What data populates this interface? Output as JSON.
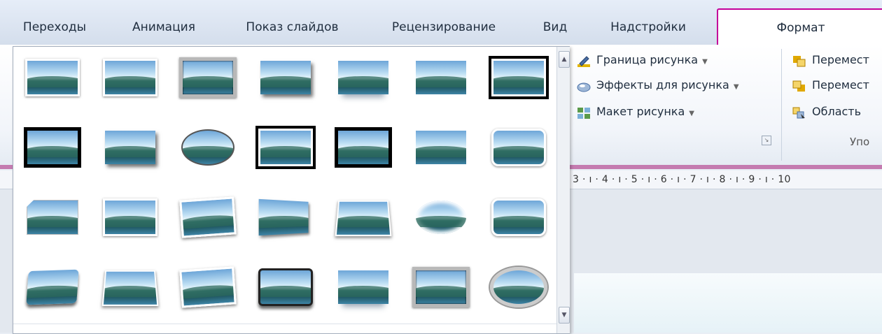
{
  "tabs": [
    {
      "label": "Переходы",
      "active": false
    },
    {
      "label": "Анимация",
      "active": false
    },
    {
      "label": "Показ слайдов",
      "active": false
    },
    {
      "label": "Рецензирование",
      "active": false
    },
    {
      "label": "Вид",
      "active": false
    },
    {
      "label": "Надстройки",
      "active": false
    },
    {
      "label": "Формат",
      "active": true
    }
  ],
  "picture_styles_group": {
    "commands": [
      {
        "label": "Граница рисунка",
        "icon": "pen-border-icon",
        "has_dropdown": true
      },
      {
        "label": "Эффекты для рисунка",
        "icon": "effects-icon",
        "has_dropdown": true
      },
      {
        "label": "Макет рисунка",
        "icon": "layout-icon",
        "has_dropdown": true
      }
    ]
  },
  "arrange_group": {
    "commands": [
      {
        "label": "Перемест",
        "icon": "bring-forward-icon"
      },
      {
        "label": "Перемест",
        "icon": "send-backward-icon"
      },
      {
        "label": "Область",
        "icon": "selection-pane-icon"
      }
    ],
    "label": "Упо"
  },
  "ruler": {
    "text": "3 · ı · 4 · ı · 5 · ı · 6 · ı · 7 · ı · 8 · ı · 9 · ı · 10"
  },
  "gallery": {
    "rows": [
      [
        "s-frame",
        "s-frame",
        "s-metal",
        "s-shadow",
        "s-reflect",
        "s-soft",
        "s-doubleblk"
      ],
      [
        "s-black",
        "s-shadow",
        "s-oval",
        "s-doubleblk",
        "s-black",
        "s-soft",
        "s-round"
      ],
      [
        "s-clip",
        "s-frame",
        "s-rot1",
        "s-rot2",
        "s-persp",
        "s-ovalsoft",
        "s-round"
      ],
      [
        "s-tilt",
        "s-persp",
        "s-rot1",
        "s-bevel",
        "s-reflect",
        "s-metal",
        "s-ovalframe"
      ]
    ]
  },
  "colors": {
    "accent_tab_border": "#c4009a",
    "ribbon_bottom": "#c47bb0"
  }
}
